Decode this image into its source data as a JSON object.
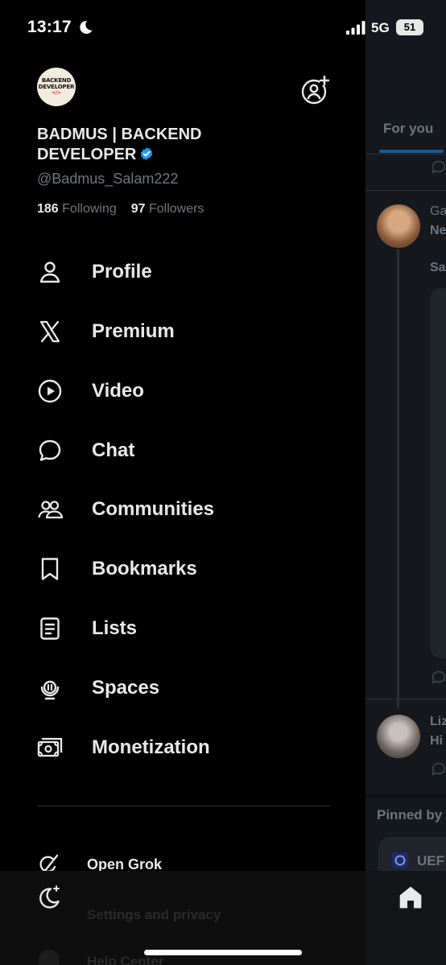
{
  "status_bar": {
    "time": "13:17",
    "network": "5G",
    "battery": "51"
  },
  "profile": {
    "avatar_text": [
      "BACKEND",
      "DEVELOPER",
      "</>"
    ],
    "display_name": "BADMUS | BACKEND DEVELOPER",
    "handle": "@Badmus_Salam222",
    "following_count": "186",
    "following_label": "Following",
    "followers_count": "97",
    "followers_label": "Followers"
  },
  "menu": [
    {
      "label": "Profile",
      "icon": "person-icon"
    },
    {
      "label": "Premium",
      "icon": "x-logo-icon"
    },
    {
      "label": "Video",
      "icon": "play-icon"
    },
    {
      "label": "Chat",
      "icon": "chat-bubble-icon"
    },
    {
      "label": "Communities",
      "icon": "communities-icon"
    },
    {
      "label": "Bookmarks",
      "icon": "bookmark-icon"
    },
    {
      "label": "Lists",
      "icon": "list-icon"
    },
    {
      "label": "Spaces",
      "icon": "microphone-icon"
    },
    {
      "label": "Monetization",
      "icon": "money-icon"
    }
  ],
  "secondary": {
    "open_grok": "Open Grok",
    "settings": "Settings and privacy",
    "help": "Help Center"
  },
  "feed": {
    "tab": "For you",
    "post1_name": "Ga",
    "post1_line2": "Ne",
    "post1_line3": "Sa",
    "post2_name": "Liz",
    "post2_line2": "Hi",
    "pinned": "Pinned by",
    "uefa": "UEF"
  },
  "colors": {
    "accent": "#1d9bf0",
    "background": "#000000",
    "text": "#e7e9ea",
    "muted": "#71767b"
  }
}
